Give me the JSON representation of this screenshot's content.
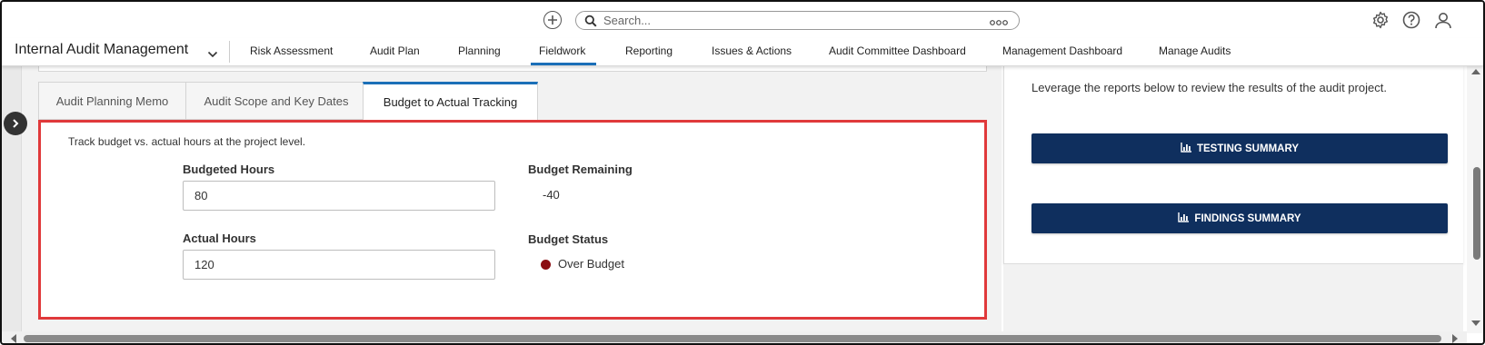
{
  "search": {
    "placeholder": "Search..."
  },
  "icons": {
    "add": "plus-circle-icon",
    "search": "search-icon",
    "more": "more-dots-icon",
    "settings": "gear-icon",
    "help": "help-icon",
    "user": "user-icon",
    "chevron": "chevron-down-icon",
    "expand": "chevron-right-icon",
    "chart": "bar-chart-icon"
  },
  "navbar": {
    "app_title": "Internal Audit Management",
    "items": [
      {
        "label": "Risk Assessment"
      },
      {
        "label": "Audit Plan"
      },
      {
        "label": "Planning"
      },
      {
        "label": "Fieldwork",
        "active": true
      },
      {
        "label": "Reporting"
      },
      {
        "label": "Issues & Actions"
      },
      {
        "label": "Audit Committee Dashboard"
      },
      {
        "label": "Management Dashboard"
      },
      {
        "label": "Manage Audits"
      }
    ]
  },
  "tabs": [
    {
      "label": "Audit Planning Memo"
    },
    {
      "label": "Audit Scope and Key Dates"
    },
    {
      "label": "Budget to Actual Tracking",
      "active": true
    }
  ],
  "budget_panel": {
    "description": "Track budget vs. actual hours at the project level.",
    "budgeted_hours_label": "Budgeted Hours",
    "budgeted_hours_value": "80",
    "actual_hours_label": "Actual Hours",
    "actual_hours_value": "120",
    "budget_remaining_label": "Budget Remaining",
    "budget_remaining_value": "-40",
    "budget_status_label": "Budget Status",
    "budget_status_value": "Over Budget",
    "status_color": "#8b0d12"
  },
  "reports_panel": {
    "description": "Leverage the reports below to review the results of the audit project.",
    "testing_summary_label": "TESTING SUMMARY",
    "findings_summary_label": "FINDINGS SUMMARY"
  },
  "colors": {
    "accent": "#1b6fb8",
    "highlight_border": "#e0393b",
    "button_bg": "#0f2f5e"
  }
}
